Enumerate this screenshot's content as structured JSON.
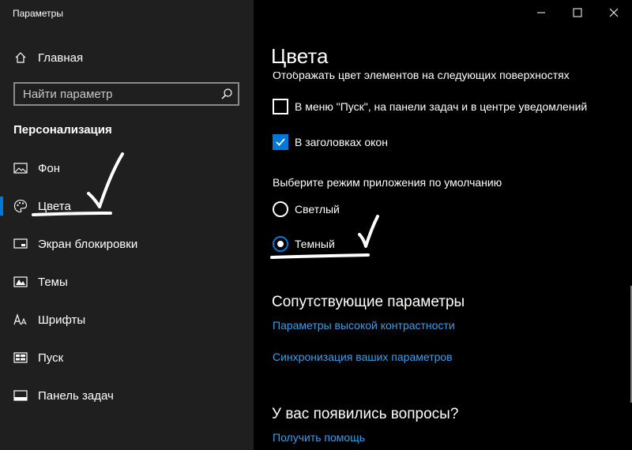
{
  "window": {
    "title": "Параметры"
  },
  "sidebar": {
    "home_label": "Главная",
    "search_placeholder": "Найти параметр",
    "section_title": "Персонализация",
    "items": [
      {
        "label": "Фон",
        "icon": "image-icon"
      },
      {
        "label": "Цвета",
        "icon": "palette-icon",
        "selected": true
      },
      {
        "label": "Экран блокировки",
        "icon": "lock-screen-icon"
      },
      {
        "label": "Темы",
        "icon": "themes-icon"
      },
      {
        "label": "Шрифты",
        "icon": "font-icon"
      },
      {
        "label": "Пуск",
        "icon": "start-icon"
      },
      {
        "label": "Панель задач",
        "icon": "taskbar-icon"
      }
    ]
  },
  "main": {
    "page_title": "Цвета",
    "surfaces_heading": "Отображать цвет элементов на следующих поверхностях",
    "checkboxes": [
      {
        "label": "В меню \"Пуск\", на панели задач и в центре уведомлений",
        "checked": false
      },
      {
        "label": "В заголовках окон",
        "checked": true
      }
    ],
    "mode_heading": "Выберите режим приложения по умолчанию",
    "radios": [
      {
        "label": "Светлый",
        "checked": false
      },
      {
        "label": "Темный",
        "checked": true
      }
    ],
    "related_heading": "Сопутствующие параметры",
    "related_links": [
      "Параметры высокой контрастности",
      "Синхронизация ваших параметров"
    ],
    "questions_heading": "У вас появились вопросы?",
    "help_link": "Получить помощь"
  },
  "colors": {
    "accent": "#0078d7",
    "link": "#3c9ee8",
    "sidebar_bg": "#1f1f1f",
    "main_bg": "#000000"
  }
}
